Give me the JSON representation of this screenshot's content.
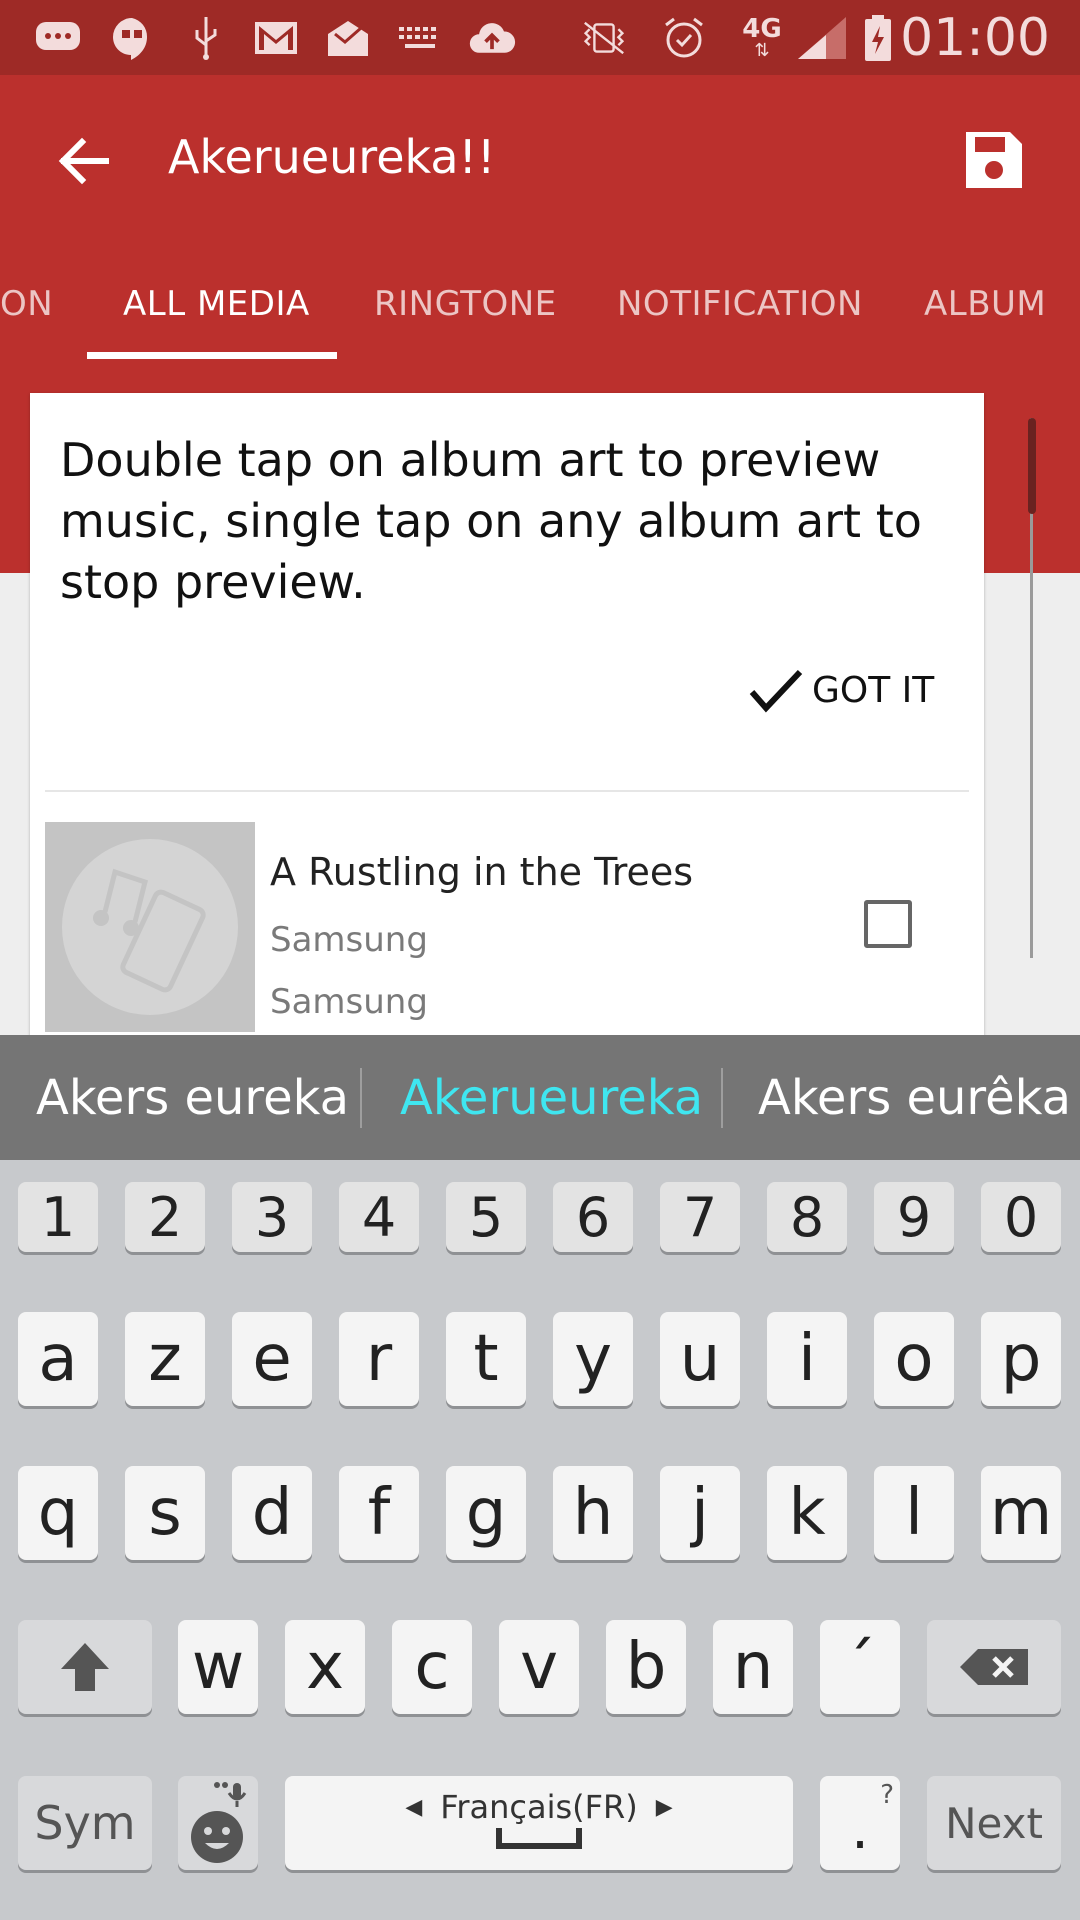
{
  "status_bar": {
    "time": "01:00",
    "network": "4G",
    "icons": [
      "messenger-icon",
      "hangouts-icon",
      "usb-icon",
      "gmail-icon",
      "mail-open-icon",
      "keyboard-icon",
      "cloud-upload-icon",
      "vibrate-icon",
      "alarm-icon",
      "signal-icon",
      "battery-charging-icon"
    ],
    "color": "#9e2a26"
  },
  "app_bar": {
    "title": "Akerueureka!!",
    "color": "#bb302d"
  },
  "tabs": [
    {
      "label": "ON",
      "active": false
    },
    {
      "label": "ALL MEDIA",
      "active": true
    },
    {
      "label": "RINGTONE",
      "active": false
    },
    {
      "label": "NOTIFICATION",
      "active": false
    },
    {
      "label": "ALBUM",
      "active": false
    }
  ],
  "tip_card": {
    "message": "Double tap on album art to preview music, single tap on any album art to stop preview.",
    "dismiss_label": "GOT IT"
  },
  "media_list": [
    {
      "title": "A Rustling in the Trees",
      "artist": "Samsung",
      "album": "Samsung",
      "checked": false
    }
  ],
  "suggestions": [
    {
      "text": "Akers eureka",
      "highlighted": false
    },
    {
      "text": "Akerueureka",
      "highlighted": true
    },
    {
      "text": "Akers eurêka",
      "highlighted": false
    }
  ],
  "keyboard": {
    "number_row": [
      "1",
      "2",
      "3",
      "4",
      "5",
      "6",
      "7",
      "8",
      "9",
      "0"
    ],
    "row1": [
      "a",
      "z",
      "e",
      "r",
      "t",
      "y",
      "u",
      "i",
      "o",
      "p"
    ],
    "row2": [
      "q",
      "s",
      "d",
      "f",
      "g",
      "h",
      "j",
      "k",
      "l",
      "m"
    ],
    "row3": [
      "w",
      "x",
      "c",
      "v",
      "b",
      "n",
      "´"
    ],
    "sym_label": "Sym",
    "language_label": "Français(FR)",
    "period_label": ".",
    "period_hint": "?",
    "next_label": "Next"
  }
}
